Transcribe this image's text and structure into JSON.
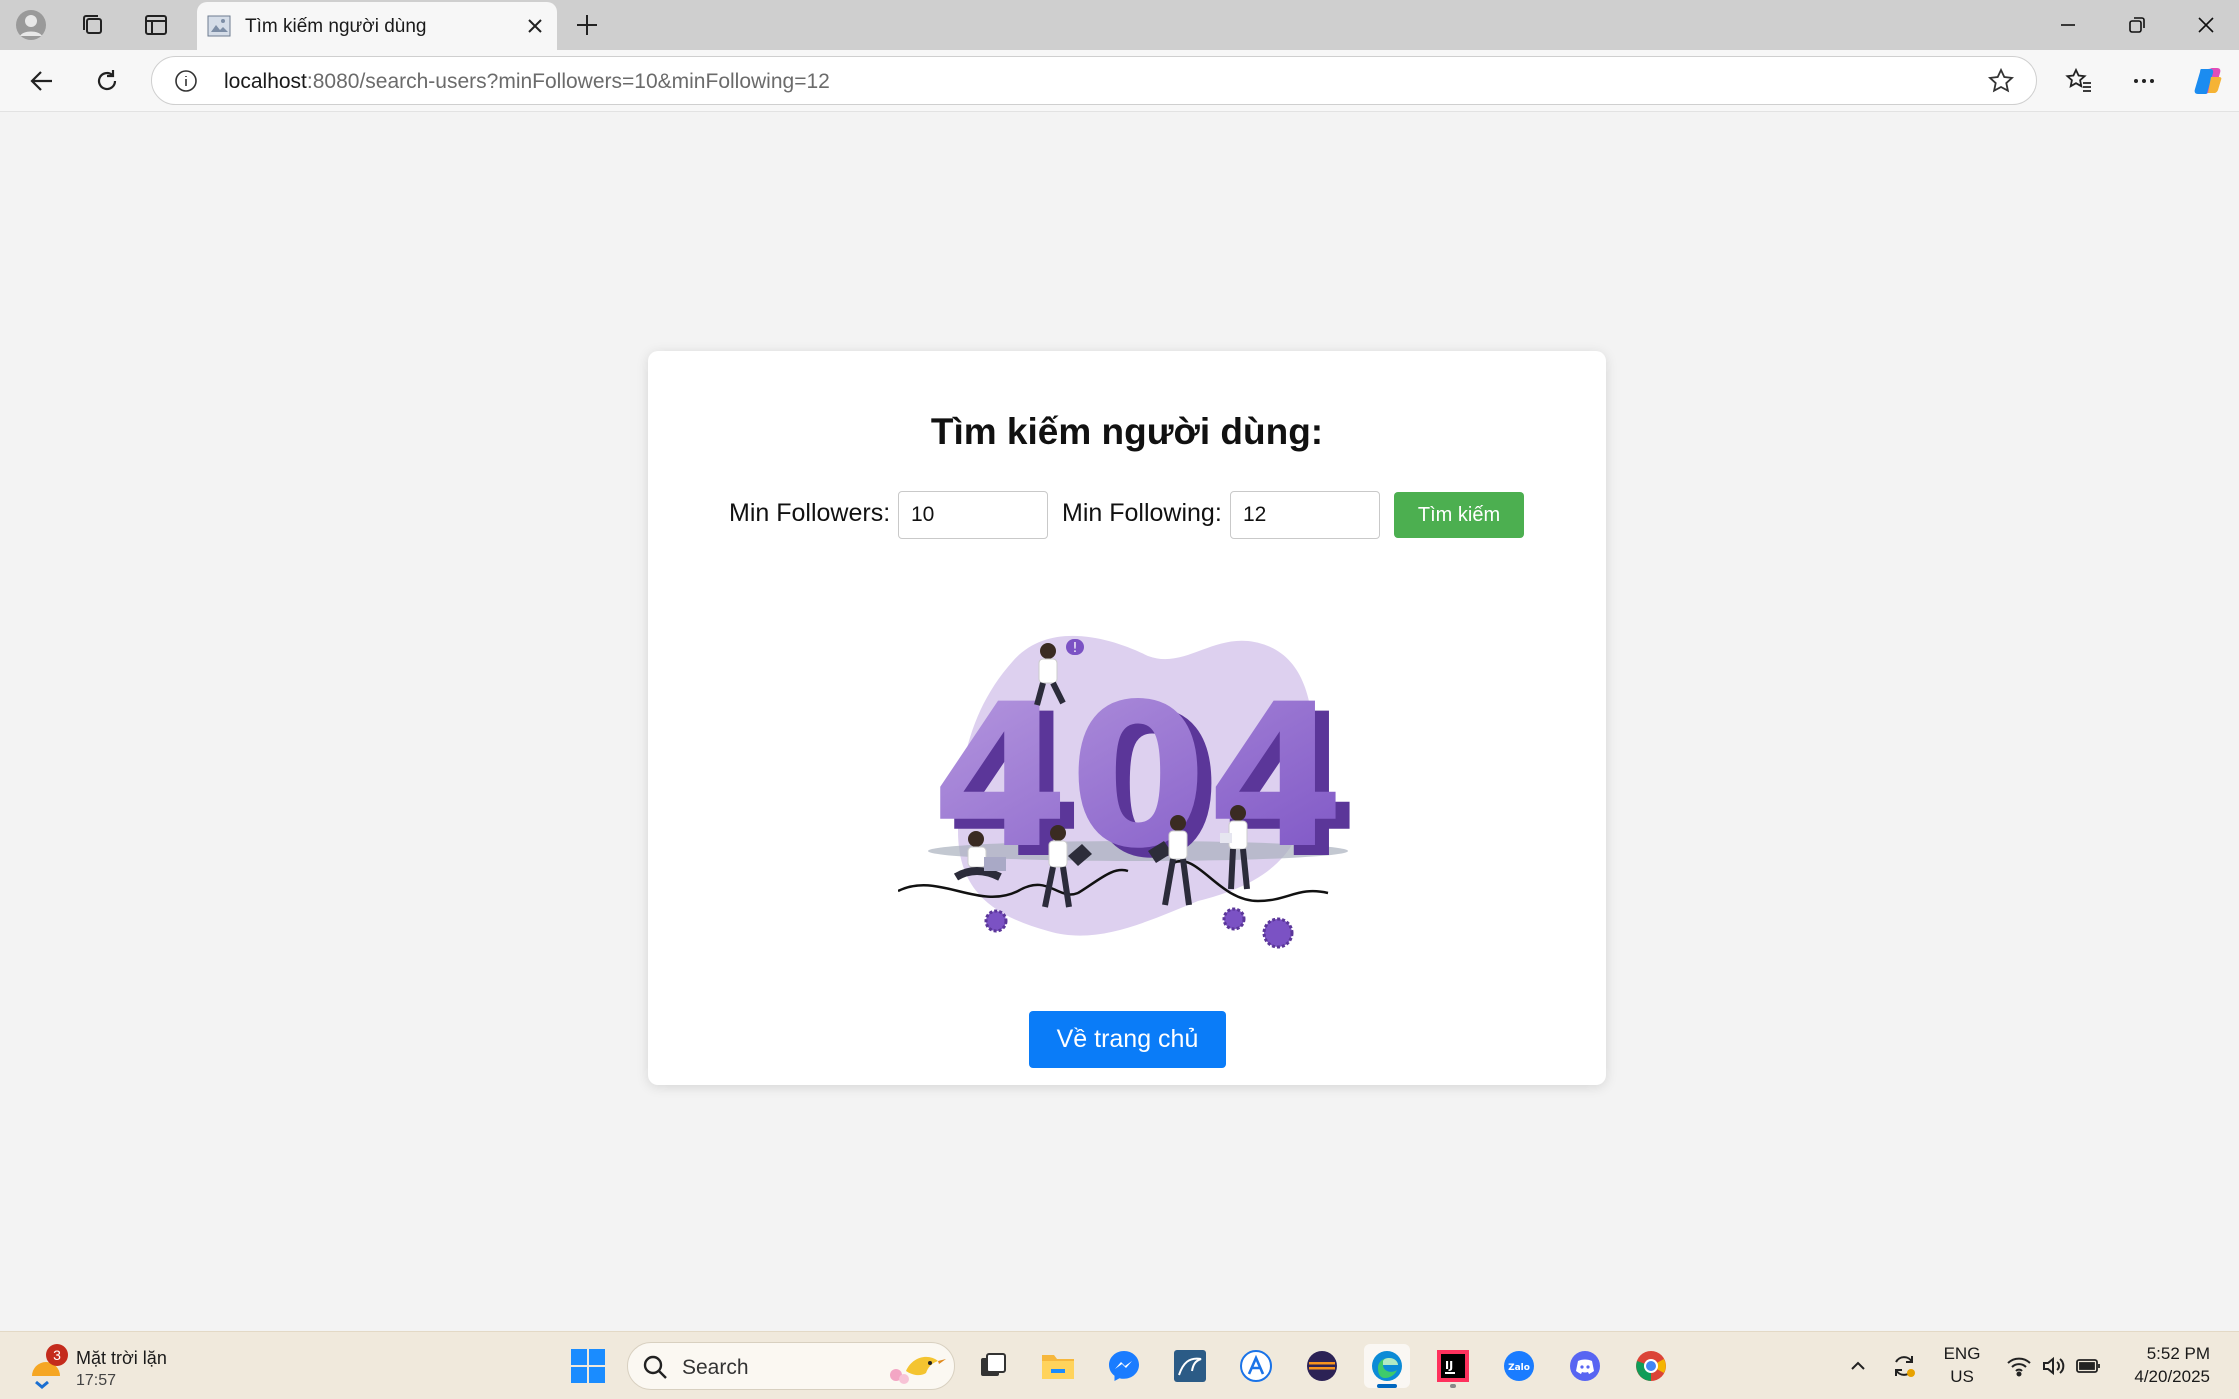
{
  "browser": {
    "tab_title": "Tìm kiếm người dùng",
    "url_host": "localhost",
    "url_rest": ":8080/search-users?minFollowers=10&minFollowing=12"
  },
  "page": {
    "heading": "Tìm kiếm người dùng:",
    "min_followers_label": "Min Followers:",
    "min_followers_value": "10",
    "min_following_label": "Min Following:",
    "min_following_value": "12",
    "search_button": "Tìm kiếm",
    "illustration_text": "404",
    "home_button": "Về trang chủ",
    "colors": {
      "search_button": "#4caf50",
      "home_button": "#0a7cf8",
      "illustration_purple": "#7e57c2"
    }
  },
  "taskbar": {
    "weather_badge": "3",
    "weather_title": "Mặt trời lặn",
    "weather_time": "17:57",
    "search_placeholder": "Search",
    "lang_line1": "ENG",
    "lang_line2": "US",
    "time": "5:52 PM",
    "date": "4/20/2025",
    "apps": [
      "task-view-icon",
      "file-explorer-icon",
      "messenger-icon",
      "mysql-workbench-icon",
      "app-a-icon",
      "eclipse-icon",
      "edge-icon",
      "intellij-icon",
      "zalo-icon",
      "discord-icon",
      "chrome-icon"
    ]
  }
}
